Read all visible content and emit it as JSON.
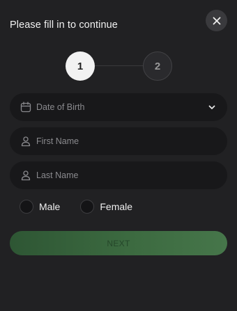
{
  "header": {
    "title": "Please fill in to continue",
    "close_icon": "close-icon"
  },
  "stepper": {
    "steps": [
      {
        "label": "1",
        "state": "active"
      },
      {
        "label": "2",
        "state": "inactive"
      }
    ]
  },
  "form": {
    "date_of_birth": {
      "placeholder": "Date of Birth",
      "icon": "calendar-icon",
      "trailing_icon": "chevron-down-icon"
    },
    "first_name": {
      "placeholder": "First Name",
      "icon": "user-icon"
    },
    "last_name": {
      "placeholder": "Last Name",
      "icon": "user-icon"
    },
    "gender": {
      "options": [
        {
          "label": "Male",
          "selected": false
        },
        {
          "label": "Female",
          "selected": false
        }
      ]
    }
  },
  "actions": {
    "next_label": "NEXT"
  },
  "colors": {
    "background": "#212123",
    "field_bg": "#18181a",
    "accent_green": "#3c6a40",
    "step_active": "#f2f2f2"
  }
}
